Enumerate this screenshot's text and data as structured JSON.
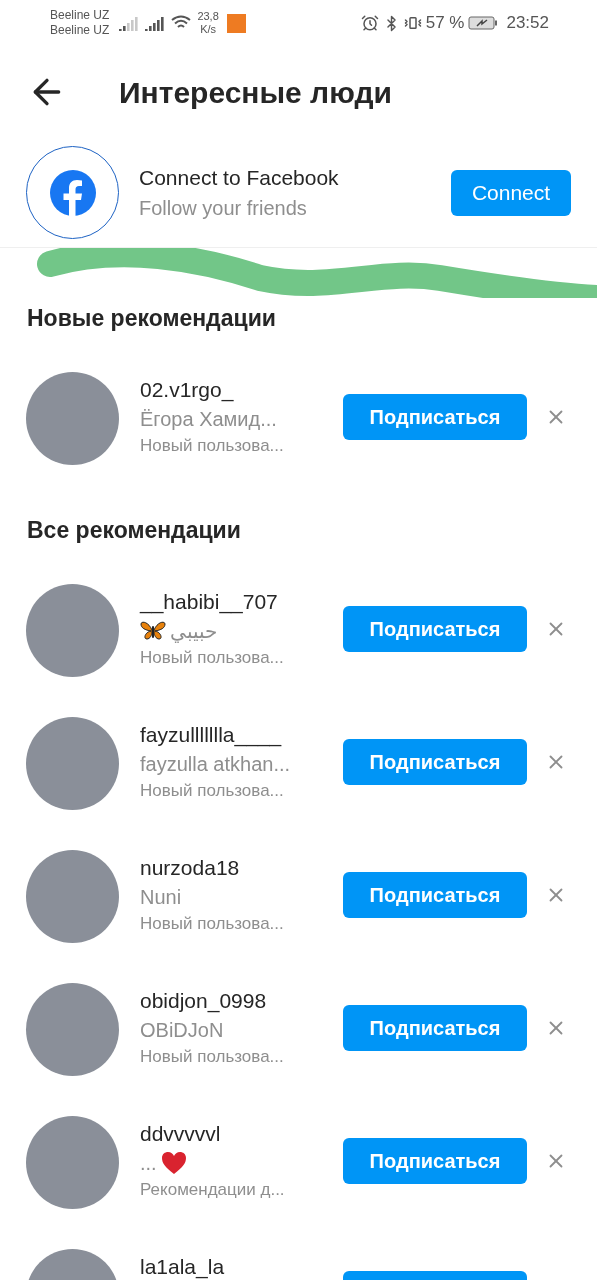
{
  "status_bar": {
    "carrier_1": "Beeline UZ",
    "carrier_2": "Beeline UZ",
    "speed_value": "23,8",
    "speed_unit": "K/s",
    "battery": "57 %",
    "time": "23:52"
  },
  "header": {
    "title": "Интересные люди"
  },
  "facebook": {
    "title": "Connect to Facebook",
    "subtitle": "Follow your friends",
    "button": "Connect"
  },
  "sections": [
    {
      "title": "Новые рекомендации",
      "people": [
        {
          "username": "02.v1rgo_",
          "name": "Ёгора Хамид...",
          "reason": "Новый пользова...",
          "button": "Подписаться",
          "kind": "plain"
        }
      ]
    },
    {
      "title": "Все рекомендации",
      "people": [
        {
          "username": "__habibi__707",
          "name": "حبيبي",
          "reason": "Новый пользова...",
          "button": "Подписаться",
          "kind": "butterfly"
        },
        {
          "username": "fayzullllllla____",
          "name": "fayzulla atkhan...",
          "reason": "Новый пользова...",
          "button": "Подписаться",
          "kind": "plain"
        },
        {
          "username": "nurzoda18",
          "name": "Nuni",
          "reason": "Новый пользова...",
          "button": "Подписаться",
          "kind": "plain"
        },
        {
          "username": "obidjon_0998",
          "name": "OBiDJoN",
          "reason": "Новый пользова...",
          "button": "Подписаться",
          "kind": "plain"
        },
        {
          "username": "ddvvvvvl",
          "name": "...",
          "reason": "Рекомендации д...",
          "button": "Подписаться",
          "kind": "heart"
        },
        {
          "username": "la1ala_la",
          "kind": "cut"
        }
      ]
    }
  ]
}
